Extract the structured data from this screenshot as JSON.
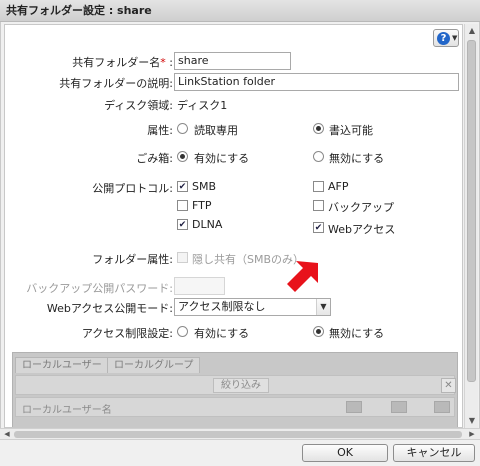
{
  "window": {
    "title": "共有フォルダー設定 : share"
  },
  "help": {
    "icon": "question-icon"
  },
  "form": {
    "name": {
      "label": "共有フォルダー名",
      "required_mark": "*",
      "colon": ":",
      "value": "share"
    },
    "description": {
      "label": "共有フォルダーの説明:",
      "value": "LinkStation folder"
    },
    "disk": {
      "label": "ディスク領域:",
      "value": "ディスク1"
    },
    "attribute": {
      "label": "属性:",
      "options": [
        "読取専用",
        "書込可能"
      ],
      "selected": "書込可能"
    },
    "trash": {
      "label": "ごみ箱:",
      "options": [
        "有効にする",
        "無効にする"
      ],
      "selected": "有効にする"
    },
    "protocols": {
      "label": "公開プロトコル:",
      "items": [
        {
          "label": "SMB",
          "checked": true
        },
        {
          "label": "AFP",
          "checked": false
        },
        {
          "label": "FTP",
          "checked": false
        },
        {
          "label": "バックアップ",
          "checked": false
        },
        {
          "label": "DLNA",
          "checked": true
        },
        {
          "label": "Webアクセス",
          "checked": true
        }
      ]
    },
    "folder_attr": {
      "label": "フォルダー属性:",
      "option": "隠し共有（SMBのみ）",
      "checked": false
    },
    "backup_password": {
      "label": "バックアップ公開パスワード:",
      "value": ""
    },
    "web_mode": {
      "label": "Webアクセス公開モード:",
      "value": "アクセス制限なし"
    },
    "access_restrict": {
      "label": "アクセス制限設定:",
      "options": [
        "有効にする",
        "無効にする"
      ],
      "selected": "無効にする"
    }
  },
  "user_panel": {
    "tabs": [
      "ローカルユーザー",
      "ローカルグループ"
    ],
    "filter_label": "絞り込み",
    "column_header": "ローカルユーザー名"
  },
  "buttons": {
    "ok": "OK",
    "cancel": "キャンセル"
  },
  "colors": {
    "accent_arrow": "#e8121b",
    "help_blue": "#2266c9"
  }
}
